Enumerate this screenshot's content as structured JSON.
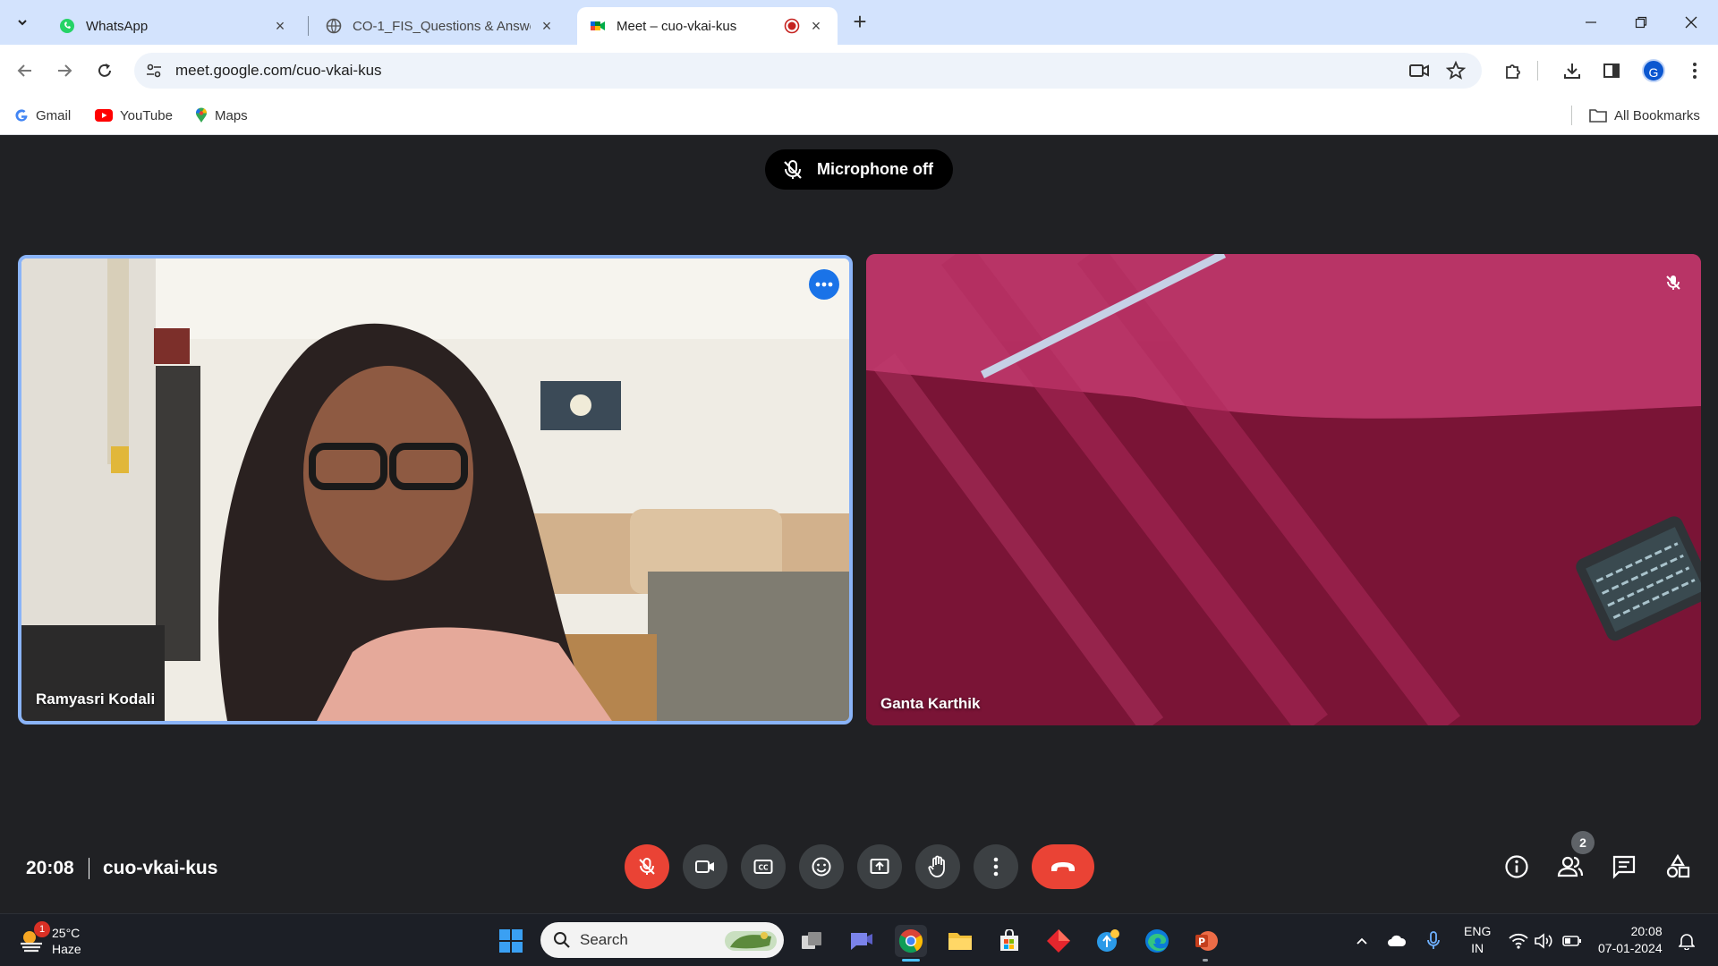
{
  "browser": {
    "tabs": [
      {
        "title": "WhatsApp",
        "active": false
      },
      {
        "title": "CO-1_FIS_Questions & Answers",
        "active": false
      },
      {
        "title": "Meet – cuo-vkai-kus",
        "active": true
      }
    ],
    "url": "meet.google.com/cuo-vkai-kus",
    "profile_initial": "G",
    "bookmarks": [
      "Gmail",
      "YouTube",
      "Maps"
    ],
    "all_bookmarks_label": "All Bookmarks"
  },
  "meet": {
    "toast": "Microphone off",
    "participants": [
      {
        "name": "Ramyasri Kodali",
        "speaking": true
      },
      {
        "name": "Ganta Karthik",
        "muted": true
      }
    ],
    "time": "20:08",
    "meeting_code": "cuo-vkai-kus",
    "participant_count": "2",
    "controls": [
      "mic-off-icon",
      "camera-icon",
      "captions-icon",
      "emoji-icon",
      "present-icon",
      "raise-hand-icon",
      "more-options-icon",
      "leave-call-icon"
    ],
    "side_controls": [
      "info-icon",
      "people-icon",
      "chat-icon",
      "activities-icon"
    ]
  },
  "taskbar": {
    "weather": {
      "temp": "25°C",
      "condition": "Haze",
      "badge": "1"
    },
    "search_label": "Search",
    "lang": {
      "line1": "ENG",
      "line2": "IN"
    },
    "clock": {
      "time": "20:08",
      "date": "07-01-2024"
    }
  },
  "colors": {
    "tabstrip": "#d3e3fd",
    "meet_bg": "#202124",
    "active_speaker": "#8ab4f8",
    "danger": "#ea4335"
  }
}
